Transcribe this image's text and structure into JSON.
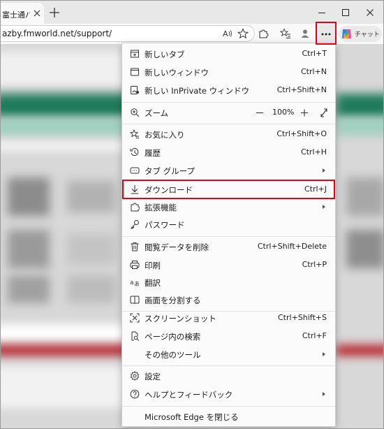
{
  "tab": {
    "title": "富士通パソコ"
  },
  "address_bar": {
    "url": "azby.fmworld.net/support/"
  },
  "copilot": {
    "label": "チャット"
  },
  "menu": {
    "new_tab": {
      "label": "新しいタブ",
      "shortcut": "Ctrl+T"
    },
    "new_window": {
      "label": "新しいウィンドウ",
      "shortcut": "Ctrl+N"
    },
    "new_inprivate": {
      "label": "新しい InPrivate ウィンドウ",
      "shortcut": "Ctrl+Shift+N"
    },
    "zoom": {
      "label": "ズーム",
      "minus": "—",
      "level": "100%",
      "plus": "+"
    },
    "favorites": {
      "label": "お気に入り",
      "shortcut": "Ctrl+Shift+O"
    },
    "history": {
      "label": "履歴",
      "shortcut": "Ctrl+H"
    },
    "tab_groups": {
      "label": "タブ グループ"
    },
    "downloads": {
      "label": "ダウンロード",
      "shortcut": "Ctrl+J"
    },
    "extensions": {
      "label": "拡張機能"
    },
    "passwords": {
      "label": "パスワード"
    },
    "clear_data": {
      "label": "閲覧データを削除",
      "shortcut": "Ctrl+Shift+Delete"
    },
    "print": {
      "label": "印刷",
      "shortcut": "Ctrl+P"
    },
    "translate": {
      "label": "翻訳"
    },
    "split_screen": {
      "label": "画面を分割する"
    },
    "screenshot": {
      "label": "スクリーンショット",
      "shortcut": "Ctrl+Shift+S"
    },
    "find": {
      "label": "ページ内の検索",
      "shortcut": "Ctrl+F"
    },
    "more_tools": {
      "label": "その他のツール"
    },
    "settings": {
      "label": "設定"
    },
    "help": {
      "label": "ヘルプとフィードバック"
    },
    "close_edge": {
      "label": "Microsoft Edge を閉じる"
    }
  },
  "colors": {
    "highlight": "#e60012",
    "menu_bg": "#fbfbfb",
    "accent": "#0067c0"
  }
}
